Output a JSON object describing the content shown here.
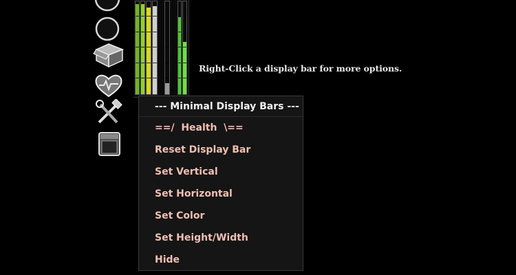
{
  "toolbar": {
    "icons": [
      {
        "name": "circle-button-top-icon"
      },
      {
        "name": "circle-button-icon"
      },
      {
        "name": "inventory-box-icon"
      },
      {
        "name": "health-heart-icon"
      },
      {
        "name": "crafting-tools-icon"
      },
      {
        "name": "stove-icon"
      }
    ]
  },
  "display_bars": [
    {
      "name": "health",
      "color": "#6fb51f",
      "level": 0.97
    },
    {
      "name": "bar-2",
      "color": "#8fcf2a",
      "level": 0.97
    },
    {
      "name": "bar-3",
      "color": "#d9d820",
      "level": 0.93
    },
    {
      "name": "bar-4",
      "color": "#cfcfcf",
      "level": 0.95
    },
    {
      "name": "bar-5",
      "color": "#9a9a9a",
      "level": 0.12
    },
    {
      "name": "bar-6",
      "color": "#48c92f",
      "level": 0.83
    },
    {
      "name": "bar-7",
      "color": "#6ee045",
      "level": 0.56
    }
  ],
  "hint_text": "Right-Click a display bar for more options.",
  "context_menu": {
    "title": "--- Minimal Display Bars ---",
    "items": [
      "==/  Health  \\==",
      "Reset Display Bar",
      "Set Vertical",
      "Set Horizontal",
      "Set Color",
      "Set Height/Width",
      "Hide"
    ]
  }
}
